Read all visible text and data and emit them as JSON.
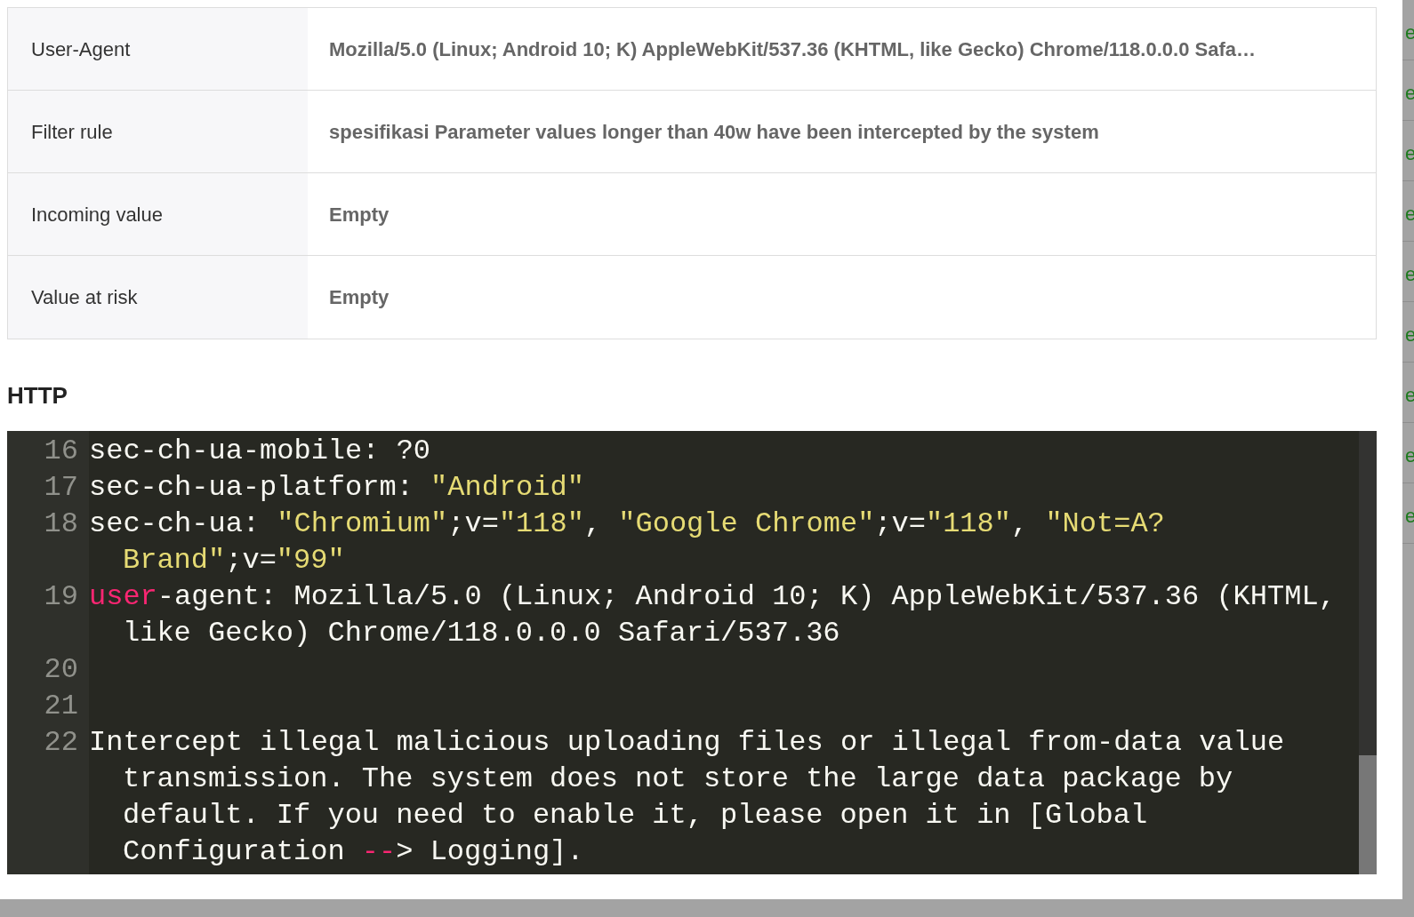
{
  "details": [
    {
      "label": "User-Agent",
      "value": "Mozilla/5.0 (Linux; Android 10; K) AppleWebKit/537.36 (KHTML, like Gecko) Chrome/118.0.0.0 Safa…"
    },
    {
      "label": "Filter rule",
      "value": "spesifikasi Parameter values longer than 40w have been intercepted by the system"
    },
    {
      "label": "Incoming value",
      "value": "Empty"
    },
    {
      "label": "Value at risk",
      "value": "Empty"
    }
  ],
  "http": {
    "title": "HTTP",
    "lines": [
      {
        "number": "16",
        "tokens": [
          {
            "kind": "plain",
            "text": "sec-ch-ua-mobile: ?0"
          }
        ]
      },
      {
        "number": "17",
        "tokens": [
          {
            "kind": "plain",
            "text": "sec-ch-ua-platform: "
          },
          {
            "kind": "string",
            "text": "\"Android\""
          }
        ]
      },
      {
        "number": "18",
        "tokens": [
          {
            "kind": "plain",
            "text": "sec-ch-ua: "
          },
          {
            "kind": "string",
            "text": "\"Chromium\""
          },
          {
            "kind": "plain",
            "text": ";v="
          },
          {
            "kind": "string",
            "text": "\"118\""
          },
          {
            "kind": "plain",
            "text": ", "
          },
          {
            "kind": "string",
            "text": "\"Google Chrome\""
          },
          {
            "kind": "plain",
            "text": ";v="
          },
          {
            "kind": "string",
            "text": "\"118\""
          },
          {
            "kind": "plain",
            "text": ", "
          },
          {
            "kind": "string",
            "text": "\"Not=A?Brand\""
          },
          {
            "kind": "plain",
            "text": ";v="
          },
          {
            "kind": "string",
            "text": "\"99\""
          }
        ]
      },
      {
        "number": "19",
        "tokens": [
          {
            "kind": "keyword",
            "text": "user"
          },
          {
            "kind": "plain",
            "text": "-agent: Mozilla/5.0 (Linux; Android 10; K) AppleWebKit/537.36 (KHTML, like Gecko) Chrome/118.0.0.0 Safari/537.36"
          }
        ]
      },
      {
        "number": "20"
      },
      {
        "number": "21"
      },
      {
        "number": "22",
        "tokens": [
          {
            "kind": "plain",
            "text": "Intercept illegal malicious uploading files or illegal from-data value transmission. The system does not store the large data package by default. If you need to enable it, please open it in [Global Configuration "
          },
          {
            "kind": "keyword",
            "text": "--"
          },
          {
            "kind": "plain",
            "text": "> Logging]."
          }
        ]
      }
    ]
  },
  "background_cells": [
    "e",
    "e",
    "e",
    "e",
    "e",
    "e",
    "e",
    "e",
    "e"
  ]
}
